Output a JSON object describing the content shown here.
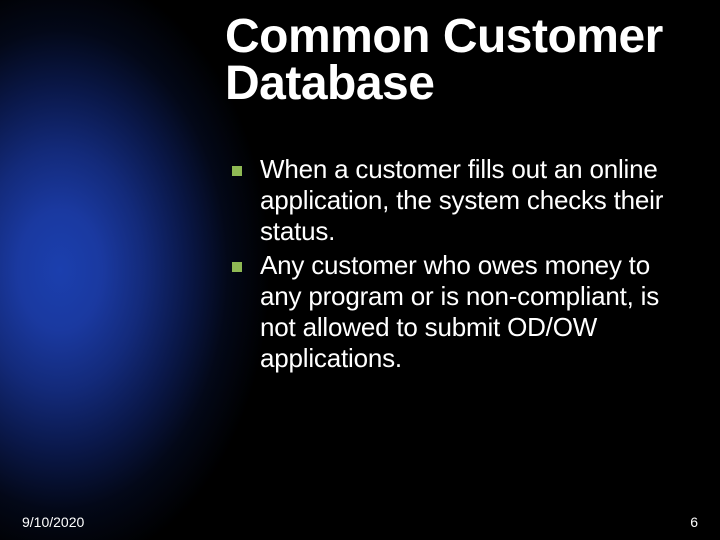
{
  "title": "Common Customer Database",
  "bullets": [
    "When a customer fills out an online application, the system checks their status.",
    "Any customer who owes money to any program or is non-compliant, is not allowed to submit OD/OW applications."
  ],
  "footer": {
    "date": "9/10/2020",
    "page": "6"
  },
  "colors": {
    "bullet": "#8fb954",
    "glow": "#1b3fae"
  }
}
